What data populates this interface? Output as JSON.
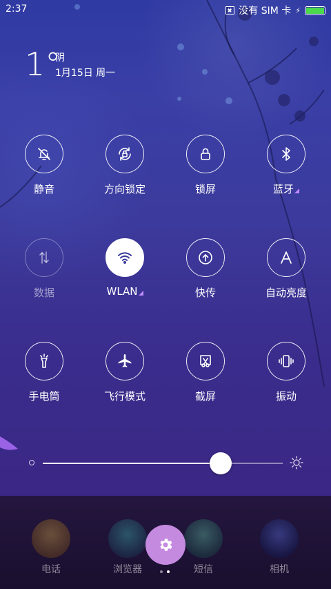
{
  "status_bar": {
    "time": "2:37",
    "sim_text": "没有 SIM 卡",
    "battery_level": 1.0,
    "battery_color": "#4cd94c"
  },
  "weather": {
    "temperature": "1°",
    "condition": "阴",
    "date": "1月15日 周一"
  },
  "toggles": [
    {
      "label": "静音",
      "icon": "bell-off-icon",
      "state": "off"
    },
    {
      "label": "方向锁定",
      "icon": "rotation-lock-icon",
      "state": "off"
    },
    {
      "label": "锁屏",
      "icon": "lock-icon",
      "state": "off"
    },
    {
      "label": "蓝牙",
      "icon": "bluetooth-icon",
      "state": "off",
      "has_more": true
    },
    {
      "label": "数据",
      "icon": "mobile-data-icon",
      "state": "disabled"
    },
    {
      "label": "WLAN",
      "icon": "wifi-icon",
      "state": "on",
      "has_more": true
    },
    {
      "label": "快传",
      "icon": "upload-icon",
      "state": "off"
    },
    {
      "label": "自动亮度",
      "icon": "auto-brightness-icon",
      "state": "off"
    },
    {
      "label": "手电筒",
      "icon": "flashlight-icon",
      "state": "off"
    },
    {
      "label": "飞行模式",
      "icon": "airplane-icon",
      "state": "off"
    },
    {
      "label": "截屏",
      "icon": "screenshot-icon",
      "state": "off"
    },
    {
      "label": "振动",
      "icon": "vibrate-icon",
      "state": "off"
    }
  ],
  "brightness": {
    "level": 0.74
  },
  "dock": {
    "apps": [
      {
        "label": "电话",
        "icon": "phone-app-icon"
      },
      {
        "label": "浏览器",
        "icon": "browser-app-icon"
      },
      {
        "label": "短信",
        "icon": "messages-app-icon"
      },
      {
        "label": "相机",
        "icon": "camera-app-icon"
      }
    ],
    "settings_icon": "gear-icon",
    "page_indicator": {
      "count": 2,
      "current": 2
    },
    "accent": "#c48ae0"
  }
}
